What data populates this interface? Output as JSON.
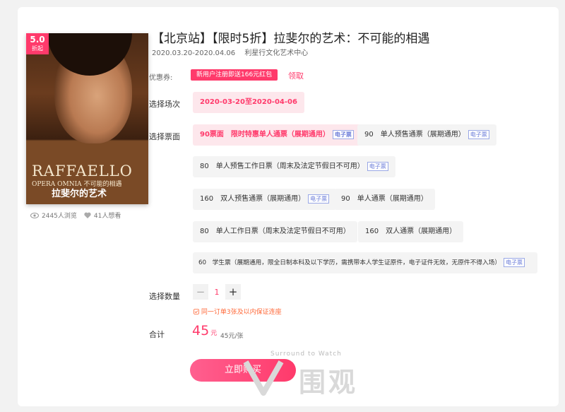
{
  "poster": {
    "rating_score": "5.0",
    "rating_unit": "折起",
    "title_en": "RAFFAELLO",
    "subtitle_en": "OPERA OMNIA 不可能的相遇",
    "title_cn": "拉斐尔的艺术"
  },
  "stats": {
    "views": "2445人浏览",
    "wants": "41人想看"
  },
  "event": {
    "title": "【北京站】【限时5折】拉斐尔的艺术：不可能的相遇",
    "dates": "2020.03.20-2020.04.06",
    "venue": "利星行文化艺术中心"
  },
  "coupon": {
    "label": "优惠券:",
    "tag": "新用户注册即送166元红包",
    "link": "领取"
  },
  "session": {
    "label": "选择场次",
    "option": "2020-03-20至2020-04-06"
  },
  "tickets": {
    "label": "选择票面",
    "etag": "电子票",
    "options": [
      {
        "text": "90票面　限时特惠单人通票（展期通用）",
        "selected": true
      },
      {
        "text": "90　单人预售通票（展期通用）",
        "selected": false
      },
      {
        "text": "80　单人预售工作日票（周末及法定节假日不可用）",
        "selected": false
      },
      {
        "text": "160　双人预售通票（展期通用）",
        "selected": false
      },
      {
        "text": "90　单人通票（展期通用）",
        "selected": false
      },
      {
        "text": "80　单人工作日票（周末及法定节假日不可用）",
        "selected": false
      },
      {
        "text": "160　双人通票（展期通用）",
        "selected": false
      },
      {
        "text": "60　学生票（展期通用，限全日制本科及以下学历，需携带本人学生证原件，电子证件无效，无原件不得入场）",
        "selected": false
      }
    ]
  },
  "quantity": {
    "label": "选择数量",
    "minus": "−",
    "value": "1",
    "plus": "+",
    "guarantee": "同一订单3张及以内保证连座"
  },
  "total": {
    "label": "合计",
    "amount": "45",
    "unit": "元",
    "per": "45元/张"
  },
  "buy_label": "立即购买",
  "watermark": {
    "text": "Surround to Watch",
    "brand": "围观"
  },
  "colors": {
    "accent": "#ff3a6b",
    "etag": "#6a7bd8"
  }
}
